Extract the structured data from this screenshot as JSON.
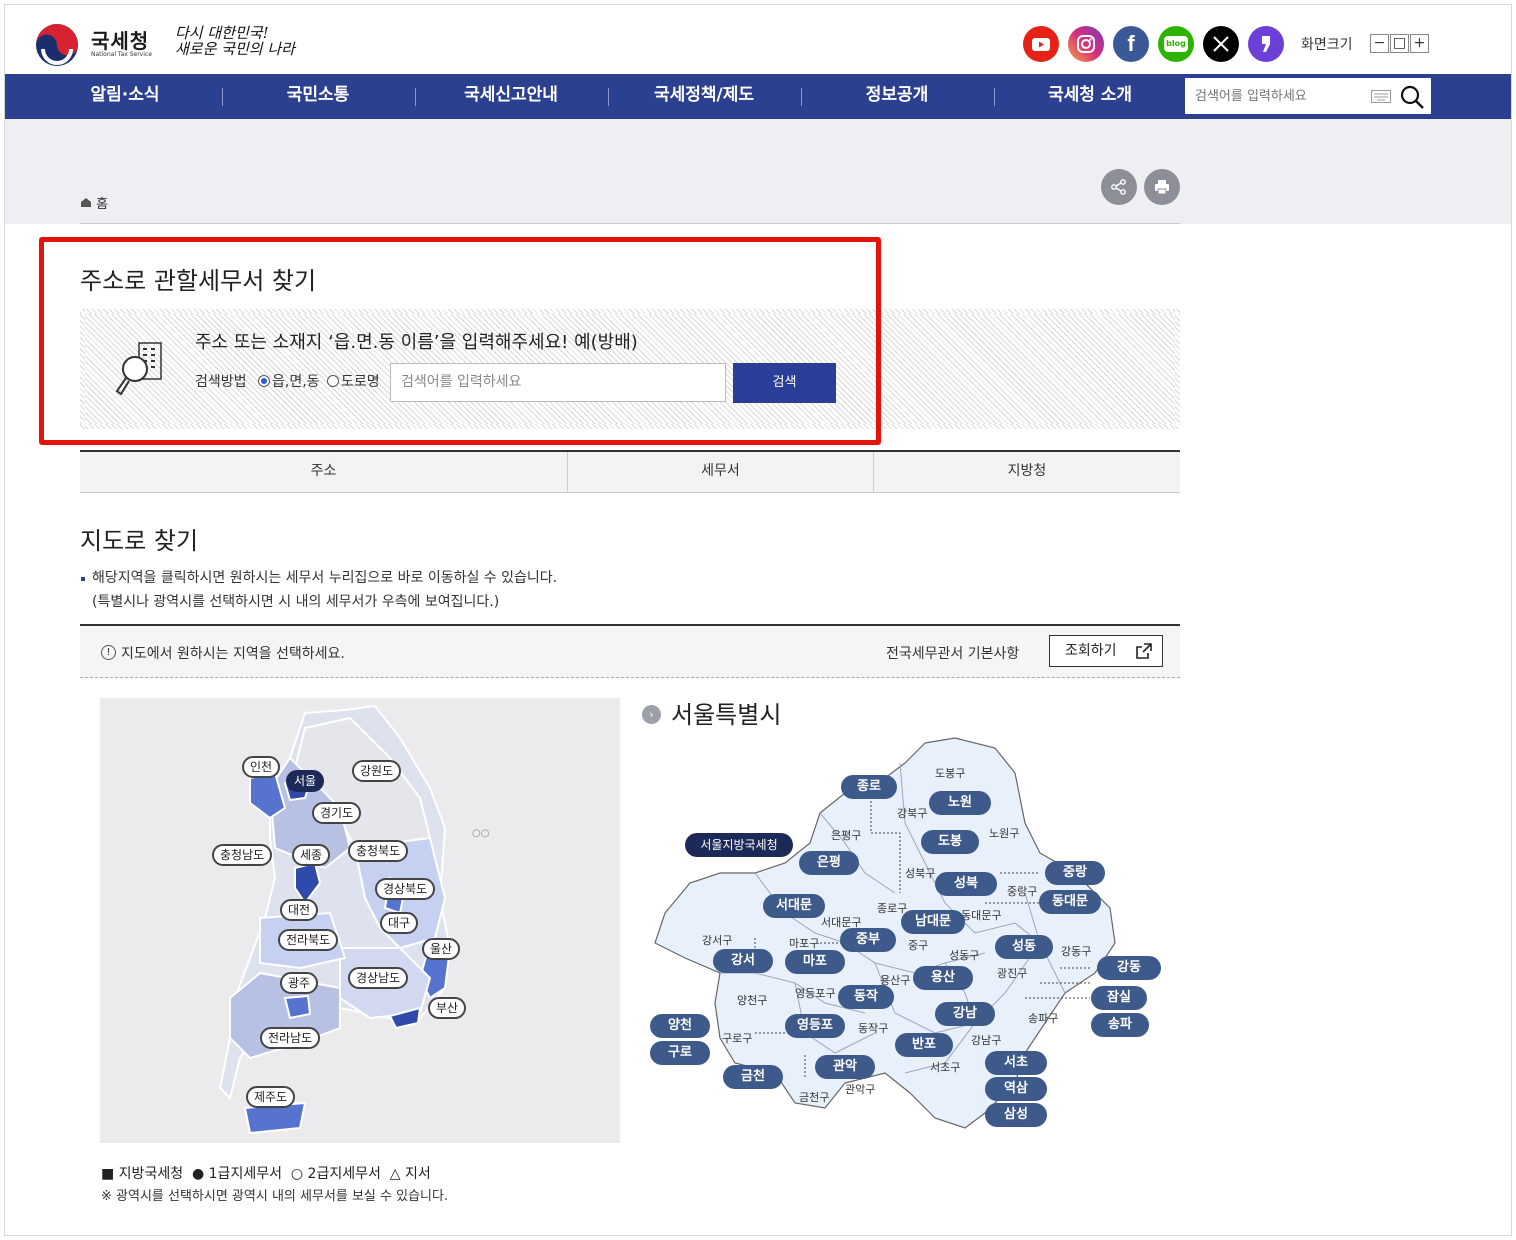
{
  "header": {
    "logo_text": "국세청",
    "logo_sub": "National Tax Service",
    "slogan_line1": "다시 대한민국!",
    "slogan_line2": "새로운 국민의 나라",
    "sns": [
      {
        "name": "youtube",
        "color": "#e62117"
      },
      {
        "name": "instagram",
        "color": "#c13584"
      },
      {
        "name": "facebook",
        "color": "#3b5998"
      },
      {
        "name": "blog",
        "color": "#2db400",
        "label": "blog"
      },
      {
        "name": "x",
        "color": "#000000"
      },
      {
        "name": "kakao-story",
        "color": "#6c3fd6"
      }
    ],
    "font_size_label": "화면크기",
    "font_minus": "−",
    "font_reset": "□",
    "font_plus": "+"
  },
  "gnb": {
    "items": [
      "알림·소식",
      "국민소통",
      "국세신고안내",
      "국세정책/제도",
      "정보공개",
      "국세청 소개"
    ],
    "search_placeholder": "검색어를 입력하세요"
  },
  "breadcrumb": {
    "home": "홈"
  },
  "address_search": {
    "title": "주소로 관할세무서 찾기",
    "guide": "주소 또는 소재지 ‘읍.면.동 이름’을 입력해주세요! 예(방배)",
    "method_label": "검색방법",
    "options": [
      "읍,면,동",
      "도로명"
    ],
    "selected": "읍,면,동",
    "input_placeholder": "검색어를 입력하세요",
    "button": "검색"
  },
  "tabs": [
    "주소",
    "세무서",
    "지방청"
  ],
  "map_search": {
    "title": "지도로 찾기",
    "desc1": "해당지역을 클릭하시면 원하시는 세무서 누리집으로 바로 이동하실 수 있습니다.",
    "desc2": "(특별시나 광역시를 선택하시면 시 내의 세무서가 우측에 보여집니다.)",
    "info": "지도에서 원하시는 지역을 선택하세요.",
    "info_icon": "!",
    "info_right": "전국세무관서 기본사항",
    "view_button": "조회하기",
    "regions": [
      "인천",
      "서울",
      "강원도",
      "경기도",
      "충청남도",
      "세종",
      "충청북도",
      "경상북도",
      "대전",
      "대구",
      "전라북도",
      "울산",
      "광주",
      "경상남도",
      "부산",
      "전라남도",
      "제주도"
    ],
    "selected_region": "서울",
    "seoul_title": "서울특별시",
    "regional_office": "서울지방국세청",
    "offices": [
      "종로",
      "노원",
      "도봉",
      "은평",
      "중랑",
      "성북",
      "동대문",
      "서대문",
      "남대문",
      "중부",
      "성동",
      "강서",
      "마포",
      "용산",
      "강동",
      "동작",
      "잠실",
      "강남",
      "양천",
      "영등포",
      "송파",
      "구로",
      "반포",
      "서초",
      "관악",
      "금천",
      "역삼",
      "삼성"
    ],
    "districts": [
      "도봉구",
      "강북구",
      "노원구",
      "은평구",
      "성북구",
      "중랑구",
      "종로구",
      "동대문구",
      "서대문구",
      "강서구",
      "마포구",
      "중구",
      "성동구",
      "광진구",
      "강동구",
      "용산구",
      "양천구",
      "영등포구",
      "송파구",
      "구로구",
      "동작구",
      "강남구",
      "서초구",
      "금천구",
      "관악구"
    ],
    "legend": {
      "regional": "■ 지방국세청",
      "first": "● 1급지세무서",
      "second": "○ 2급지세무서",
      "branch": "△ 지서"
    },
    "legend_note": "※ 광역시를 선택하시면 광역시 내의 세무서를 보실 수 있습니다."
  },
  "colors": {
    "gnb": "#2b418f",
    "button": "#2b3f98",
    "highlight": "#e3120b",
    "office_pill": "#3e5a8a",
    "regional_pill": "#1d2a58"
  }
}
